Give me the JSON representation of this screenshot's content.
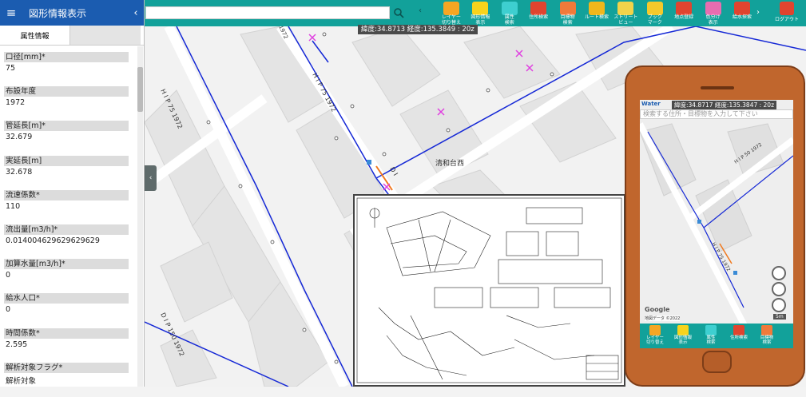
{
  "panel": {
    "title": "図形情報表示",
    "menu_icon": "≡",
    "collapse_icon": "‹",
    "tabs": [
      "属性情報",
      ""
    ],
    "attributes": [
      {
        "label": "口径[mm]*",
        "value": "75"
      },
      {
        "label": "布設年度",
        "value": "1972"
      },
      {
        "label": "管延長[m]*",
        "value": "32.679"
      },
      {
        "label": "実延長[m]",
        "value": "32.678"
      },
      {
        "label": "流速係数*",
        "value": "110"
      },
      {
        "label": "流出量[m3/h]*",
        "value": "0.014004629629629629"
      },
      {
        "label": "加算水量[m3/h]*",
        "value": "0"
      },
      {
        "label": "給水人口*",
        "value": "0"
      },
      {
        "label": "時間係数*",
        "value": "2.595"
      },
      {
        "label": "解析対象フラグ*",
        "value": "解析対象"
      }
    ]
  },
  "toolbar": {
    "search_value": "",
    "left_arrow": "‹",
    "right_arrow": "›",
    "tools": [
      {
        "label": "レイヤー\n切り替え",
        "icon": "layers-icon",
        "color": "#f5a623"
      },
      {
        "label": "図形情報\n表示",
        "icon": "note-icon",
        "color": "#f7d31c"
      },
      {
        "label": "属性\n検索",
        "icon": "magnifier-icon",
        "color": "#3ecfd0"
      },
      {
        "label": "住所検索",
        "icon": "house-icon",
        "color": "#e0442f"
      },
      {
        "label": "目標物\n検索",
        "icon": "landmark-icon",
        "color": "#f07a3a"
      },
      {
        "label": "ルート検索",
        "icon": "route-sign-icon",
        "color": "#f0b71c"
      },
      {
        "label": "ストリート\nビュー",
        "icon": "street-view-icon",
        "color": "#f2d34a"
      },
      {
        "label": "ブック\nマーク",
        "icon": "star-icon",
        "color": "#f4c92b"
      },
      {
        "label": "地点登録",
        "icon": "pin-icon",
        "color": "#e0442f"
      },
      {
        "label": "色分け\n表示",
        "icon": "palette-icon",
        "color": "#e86db0"
      },
      {
        "label": "給水探索",
        "icon": "pipe-icon",
        "color": "#e0442f"
      }
    ],
    "logout_label": "ログアウト"
  },
  "map": {
    "coord_label": "緯度:34.8713 経度:135.3849 : 20z",
    "town_label": "清和台西",
    "pipe_labels": [
      "H I P  75  1972",
      "H I P  75  1972",
      "D I P  150  1972",
      "D I",
      "1972"
    ]
  },
  "phone": {
    "logo": "Water",
    "coord_label": "緯度:34.8717 経度:135.3847 : 20z",
    "search_placeholder": "検索する住所・目標物を入力して下さい",
    "google": "Google",
    "copyright": "地図データ ©2022",
    "scale": "5m",
    "tools": [
      {
        "label": "レイヤー\n切り替え",
        "color": "#f5a623"
      },
      {
        "label": "図形情報\n表示",
        "color": "#f7d31c"
      },
      {
        "label": "属性\n検索",
        "color": "#3ecfd0"
      },
      {
        "label": "住所検索",
        "color": "#e0442f"
      },
      {
        "label": "目標物\n検索",
        "color": "#f07a3a"
      }
    ]
  }
}
